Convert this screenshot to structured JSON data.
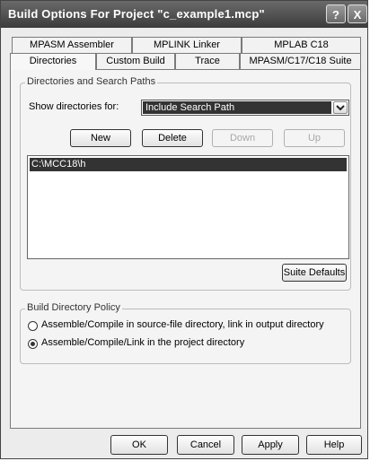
{
  "window": {
    "title": "Build Options For Project \"c_example1.mcp\"",
    "help_button": "?",
    "close_button": "X"
  },
  "tabs": {
    "row_back": [
      "MPASM Assembler",
      "MPLINK Linker",
      "MPLAB C18"
    ],
    "row_front": [
      "Directories",
      "Custom Build",
      "Trace",
      "MPASM/C17/C18 Suite"
    ],
    "active": "Directories"
  },
  "directories_group": {
    "label": "Directories and Search Paths",
    "show_label": "Show directories for:",
    "show_value": "Include Search Path",
    "buttons": {
      "new": "New",
      "delete": "Delete",
      "down": "Down",
      "up": "Up"
    },
    "items": [
      "C:\\MCC18\\h"
    ],
    "suite_defaults": "Suite Defaults"
  },
  "policy_group": {
    "label": "Build Directory Policy",
    "options": [
      {
        "label": "Assemble/Compile in source-file directory, link in output directory",
        "checked": false
      },
      {
        "label": "Assemble/Compile/Link in the project directory",
        "checked": true
      }
    ]
  },
  "footer": {
    "ok": "OK",
    "cancel": "Cancel",
    "apply": "Apply",
    "help": "Help"
  }
}
